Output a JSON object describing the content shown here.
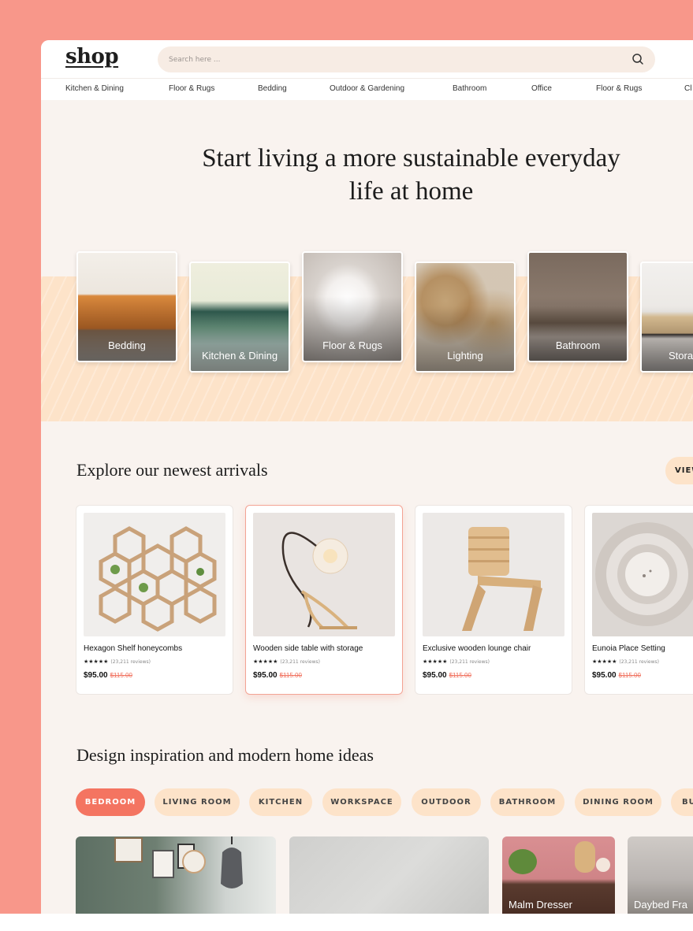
{
  "header": {
    "logo": "shop",
    "search_placeholder": "Search here ..."
  },
  "nav": [
    "Kitchen & Dining",
    "Floor & Rugs",
    "Bedding",
    "Outdoor & Gardening",
    "Bathroom",
    "Office",
    "Floor & Rugs",
    "Cl"
  ],
  "hero": {
    "title_line1": "Start living a more sustainable everyday",
    "title_line2": "life at home"
  },
  "categories": [
    {
      "label": "Bedding"
    },
    {
      "label": "Kitchen & Dining"
    },
    {
      "label": "Floor & Rugs"
    },
    {
      "label": "Lighting"
    },
    {
      "label": "Bathroom"
    },
    {
      "label": "Stora"
    }
  ],
  "arrivals": {
    "title": "Explore our newest arrivals",
    "view_label": "VIEW",
    "products": [
      {
        "name": "Hexagon Shelf  honeycombs",
        "stars": "★★★★★",
        "reviews": "(23,211 reviews)",
        "price": "$95.00",
        "old_price": "$115.00"
      },
      {
        "name": "Wooden side table with storage",
        "stars": "★★★★★",
        "reviews": "(23,211 reviews)",
        "price": "$95.00",
        "old_price": "$115.00"
      },
      {
        "name": "Exclusive wooden lounge chair",
        "stars": "★★★★★",
        "reviews": "(23,211 reviews)",
        "price": "$95.00",
        "old_price": "$115.00"
      },
      {
        "name": "Eunoia Place Setting",
        "stars": "★★★★★",
        "reviews": "(23,211 reviews)",
        "price": "$95.00",
        "old_price": "$115.00"
      }
    ]
  },
  "inspiration": {
    "title": "Design inspiration and modern home ideas",
    "pills": [
      "BEDROOM",
      "LIVING ROOM",
      "KITCHEN",
      "WORKSPACE",
      "OUTDOOR",
      "BATHROOM",
      "DINING ROOM",
      "BU"
    ],
    "tiles": [
      "",
      "",
      "Malm Dresser",
      "Daybed Fra"
    ]
  },
  "colors": {
    "background": "#f8978a",
    "accent": "#f47461",
    "pill": "#fde3c9",
    "surface": "#f9f3ef"
  }
}
